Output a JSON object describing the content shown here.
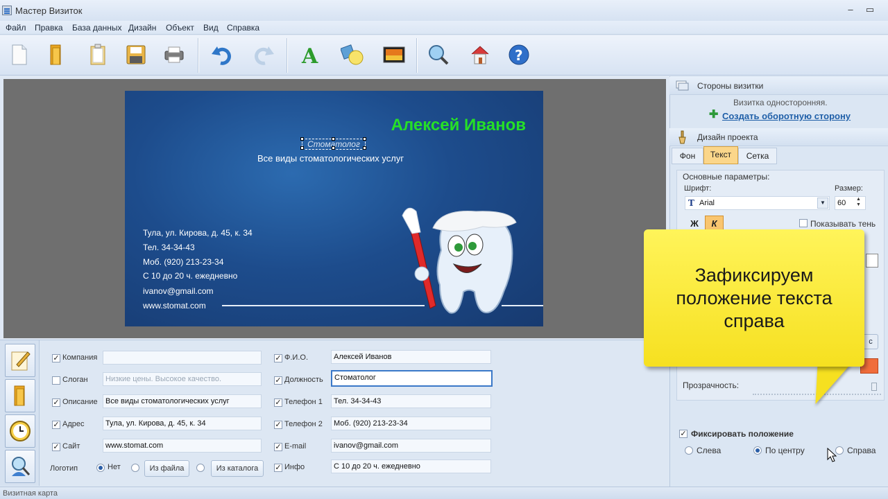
{
  "window": {
    "title": "Мастер Визиток"
  },
  "menu": [
    "Файл",
    "Правка",
    "База данных",
    "Дизайн",
    "Объект",
    "Вид",
    "Справка"
  ],
  "toolbar": {
    "buttons": [
      "new-document-icon",
      "open-folder-icon",
      "clipboard-icon",
      "save-disk-icon",
      "print-icon",
      "undo-icon",
      "redo-icon",
      "text-a-icon",
      "shapes-icon",
      "image-icon",
      "zoom-search-icon",
      "home-icon",
      "help-icon"
    ]
  },
  "card": {
    "name": "Алексей Иванов",
    "position": "Стоматолог",
    "description": "Все виды стоматологических услуг",
    "address": "Тула, ул. Кирова, д. 45, к. 34",
    "phone1": "Тел. 34-34-43",
    "phone2": "Моб. (920) 213-23-34",
    "info": "С 10 до 20 ч. ежедневно",
    "email": "ivanov@gmail.com",
    "site": "www.stomat.com",
    "colors": {
      "name": "#26e027",
      "background": "#1d4c8c"
    }
  },
  "form": {
    "left": [
      {
        "label": "Компания",
        "checked": true,
        "value": "",
        "placeholder": ""
      },
      {
        "label": "Слоган",
        "checked": false,
        "value": "",
        "placeholder": "Низкие цены. Высокое качество."
      },
      {
        "label": "Описание",
        "checked": true,
        "value": "Все виды стоматологических услуг",
        "placeholder": ""
      },
      {
        "label": "Адрес",
        "checked": true,
        "value": "Тула, ул. Кирова, д. 45, к. 34",
        "placeholder": ""
      },
      {
        "label": "Сайт",
        "checked": true,
        "value": "www.stomat.com",
        "placeholder": ""
      }
    ],
    "logo": {
      "label": "Логотип",
      "option_none": "Нет",
      "from_file": "Из файла",
      "from_catalog": "Из каталога"
    },
    "right": [
      {
        "label": "Ф.И.О.",
        "checked": true,
        "value": "Алексей Иванов"
      },
      {
        "label": "Должность",
        "checked": true,
        "value": "Стоматолог"
      },
      {
        "label": "Телефон 1",
        "checked": true,
        "value": "Тел. 34-34-43"
      },
      {
        "label": "Телефон 2",
        "checked": true,
        "value": "Моб. (920) 213-23-34"
      },
      {
        "label": "E-mail",
        "checked": true,
        "value": "ivanov@gmail.com"
      },
      {
        "label": "Инфо",
        "checked": true,
        "value": "С 10 до 20 ч. ежедневно"
      }
    ]
  },
  "right_panel": {
    "sides_title": "Стороны визитки",
    "sides_info": "Визитка односторонняя.",
    "create_back_link": "Создать оборотную сторону",
    "design_title": "Дизайн проекта",
    "tabs": [
      "Фон",
      "Текст",
      "Сетка"
    ],
    "active_tab": "Текст",
    "basic_params": "Основные параметры:",
    "font_label": "Шрифт:",
    "font_value": "Arial",
    "size_label": "Размер:",
    "size_value": "60",
    "bold_label": "Ж",
    "italic_label": "К",
    "show_shadow": "Показывать тень",
    "transparency": "Прозрачность:",
    "fix_position": "Фиксировать положение",
    "align_left": "Слева",
    "align_center": "По центру",
    "align_right": "Справа",
    "selected_align": "По центру",
    "transparency_level": 1.0
  },
  "callout": {
    "line1": "Зафиксируем",
    "line2": "положение текста",
    "line3": "справа"
  },
  "status": {
    "text": "Визитная карта"
  }
}
